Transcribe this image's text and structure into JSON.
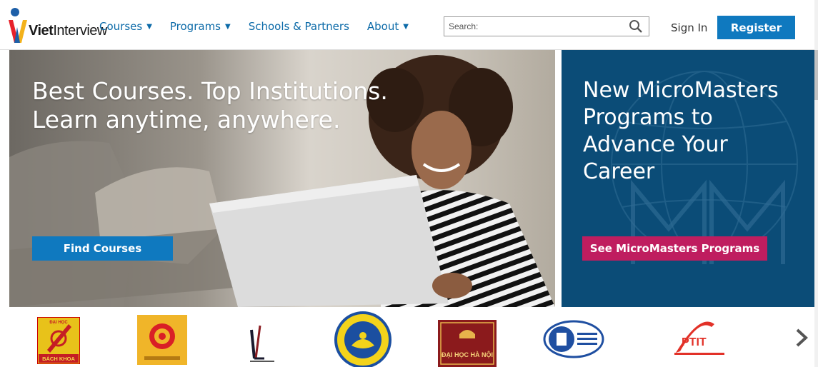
{
  "header": {
    "brand_name": "VietInterview",
    "nav": [
      {
        "label": "Courses",
        "caret": true
      },
      {
        "label": "Programs",
        "caret": true
      },
      {
        "label": "Schools & Partners",
        "caret": false
      },
      {
        "label": "About",
        "caret": true
      }
    ],
    "search_placeholder": "Search:",
    "sign_in": "Sign In",
    "register": "Register"
  },
  "hero": {
    "title": "Best Courses. Top Institutions.\nLearn anytime, anywhere.",
    "button": "Find Courses"
  },
  "promo": {
    "title": "New MicroMasters Programs to Advance Your Career",
    "button": "See MicroMasters Programs"
  },
  "partners": {
    "logo_texts": {
      "bachkhoa_top": "ĐẠI HỌC",
      "bachkhoa_bottom": "BÁCH KHOA",
      "hanoi": "ĐẠI HỌC HÀ NỘI",
      "ptit": "PTIT"
    }
  },
  "colors": {
    "accent": "#0f79bf",
    "promo_bg": "#0b4c77",
    "micromasters_btn": "#bf1d5f",
    "nav_link": "#0b6aa8"
  }
}
